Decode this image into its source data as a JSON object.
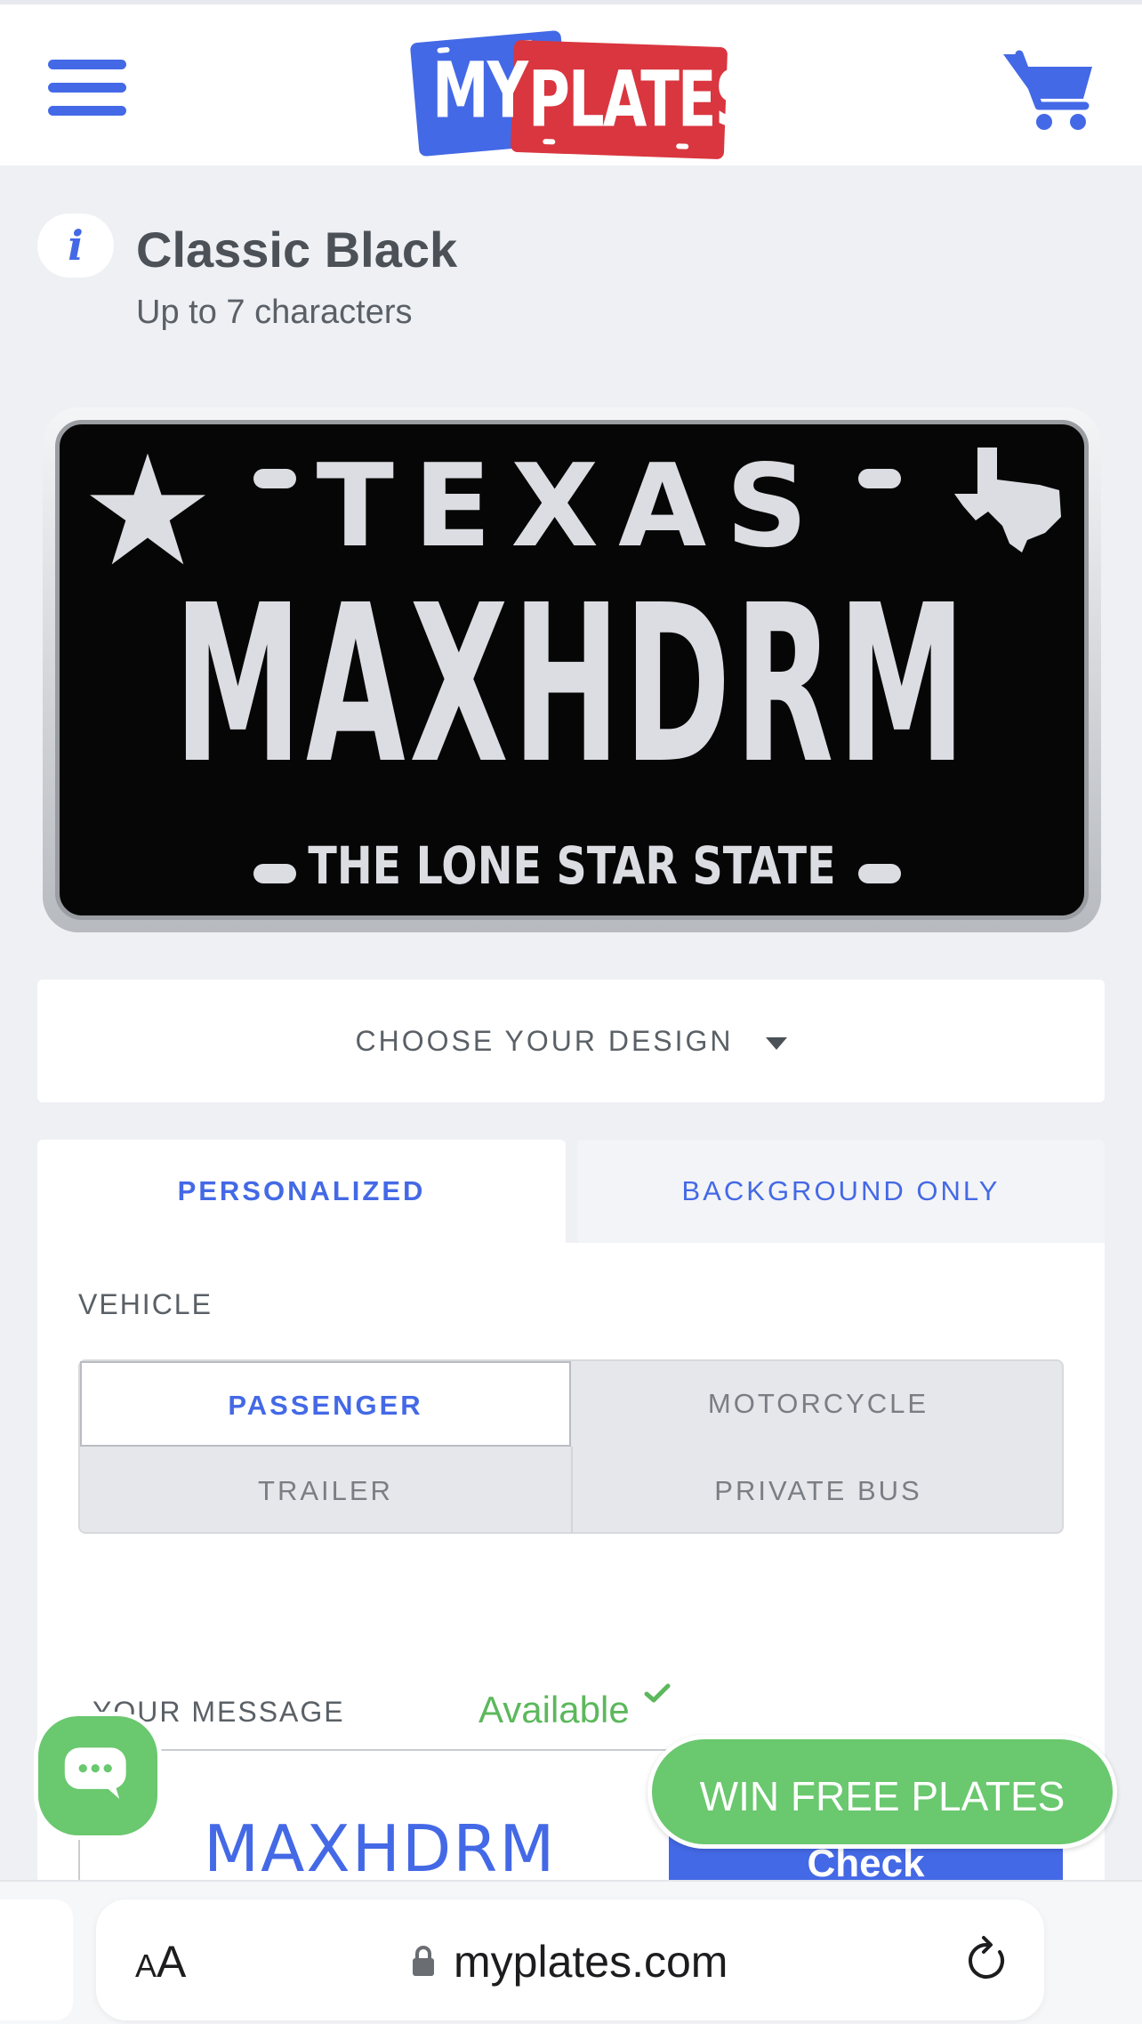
{
  "header": {
    "logo": {
      "part1": "MY",
      "part2": "PLATES"
    }
  },
  "plate_info": {
    "title": "Classic Black",
    "subtitle": "Up to 7 characters",
    "info_icon": "i"
  },
  "plate": {
    "state": "TEXAS",
    "text": "MAXHDRM",
    "slogan": "THE LONE STAR STATE"
  },
  "design": {
    "label": "CHOOSE YOUR DESIGN"
  },
  "tabs": [
    {
      "label": "PERSONALIZED",
      "active": true
    },
    {
      "label": "BACKGROUND ONLY",
      "active": false
    }
  ],
  "vehicle": {
    "label": "VEHICLE",
    "options": [
      "PASSENGER",
      "MOTORCYCLE",
      "TRAILER",
      "PRIVATE BUS"
    ],
    "selected": "PASSENGER"
  },
  "message": {
    "label": "YOUR MESSAGE",
    "status": "Available",
    "value": "MAXHDRM",
    "check_label": "Check"
  },
  "promo": {
    "win_label": "WIN FREE PLATES"
  },
  "browser": {
    "aa_small": "A",
    "aa_big": "A",
    "url": "myplates.com"
  },
  "colors": {
    "brand_blue": "#4469e6",
    "brand_red": "#d9363f",
    "available_green": "#5cb85c",
    "promo_green": "#6ac86e"
  },
  "icons": [
    "menu-icon",
    "cart-icon",
    "info-icon",
    "star-icon",
    "texas-icon",
    "caret-down-icon",
    "check-icon",
    "chat-icon",
    "lock-icon",
    "reload-icon"
  ]
}
